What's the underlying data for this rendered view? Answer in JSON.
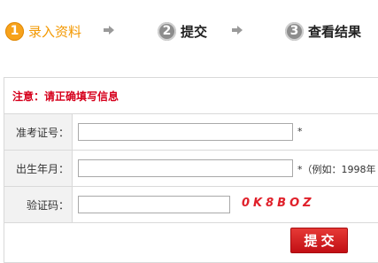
{
  "steps": [
    {
      "number": "1",
      "label": "录入资料",
      "state": "active",
      "color": "#f39800"
    },
    {
      "number": "2",
      "label": "提交",
      "state": "inactive"
    },
    {
      "number": "3",
      "label": "查看结果",
      "state": "inactive"
    }
  ],
  "form": {
    "notice": "注意：请正确填写信息",
    "fields": [
      {
        "label": "准考证号：",
        "value": "",
        "placeholder": "",
        "hint": "*"
      },
      {
        "label": "出生年月：",
        "value": "",
        "placeholder": "",
        "hint": "*（例如：1998年"
      },
      {
        "label": "验证码：",
        "value": "",
        "placeholder": "",
        "captcha": "0K8BOZ"
      }
    ],
    "submit_label": "提交"
  },
  "colors": {
    "accent": "#f39800",
    "notice": "#d6001c",
    "button": "#d0171c",
    "captcha": "#e0202a"
  }
}
